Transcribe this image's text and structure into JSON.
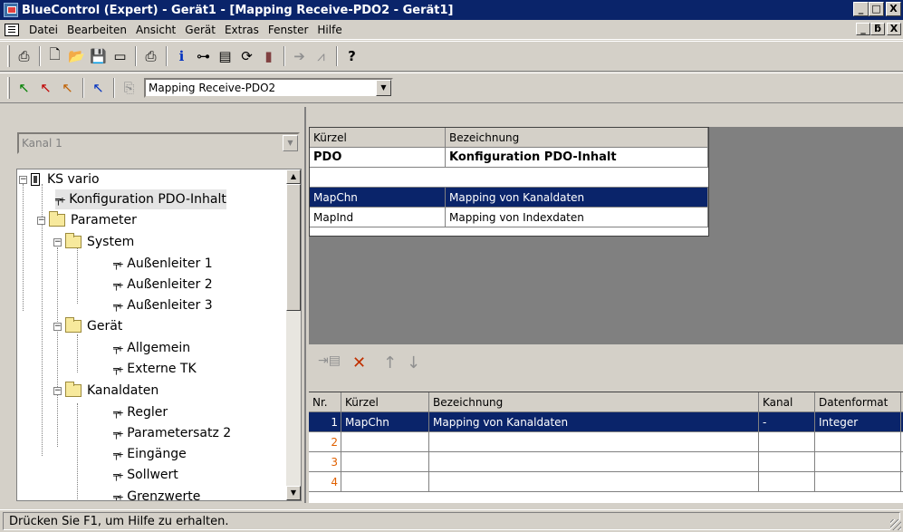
{
  "window": {
    "title": "BlueControl (Expert) - Gerät1 - [Mapping Receive-PDO2 - Gerät1]",
    "minimize": "_",
    "maximize": "□",
    "close": "X",
    "restore": "ƃ"
  },
  "menu": [
    "Datei",
    "Bearbeiten",
    "Ansicht",
    "Gerät",
    "Extras",
    "Fenster",
    "Hilfe"
  ],
  "toolbar2": {
    "combo_value": "Mapping Receive-PDO2"
  },
  "left": {
    "kanal_combo": "Kanal 1",
    "tree": [
      "KS vario",
      "Konfiguration PDO-Inhalt",
      "Parameter",
      "System",
      "Außenleiter 1",
      "Außenleiter 2",
      "Außenleiter 3",
      "Gerät",
      "Allgemein",
      "Externe TK",
      "Kanaldaten",
      "Regler",
      "Parametersatz 2",
      "Eingänge",
      "Sollwert",
      "Grenzwerte"
    ]
  },
  "top_table": {
    "headers": [
      "Kürzel",
      "Bezeichnung"
    ],
    "rows": [
      [
        "PDO",
        "Konfiguration PDO-Inhalt"
      ],
      [
        "",
        ""
      ],
      [
        "MapChn",
        "Mapping von Kanaldaten"
      ],
      [
        "MapInd",
        "Mapping von Indexdaten"
      ]
    ]
  },
  "bottom_table": {
    "headers": [
      "Nr.",
      "Kürzel",
      "Bezeichnung",
      "Kanal",
      "Datenformat"
    ],
    "rows": [
      [
        "1",
        "MapChn",
        "Mapping von Kanaldaten",
        "-",
        "Integer"
      ],
      [
        "2",
        "",
        "",
        "",
        ""
      ],
      [
        "3",
        "",
        "",
        "",
        ""
      ],
      [
        "4",
        "",
        "",
        "",
        ""
      ]
    ]
  },
  "status": "Drücken Sie F1, um Hilfe zu erhalten."
}
